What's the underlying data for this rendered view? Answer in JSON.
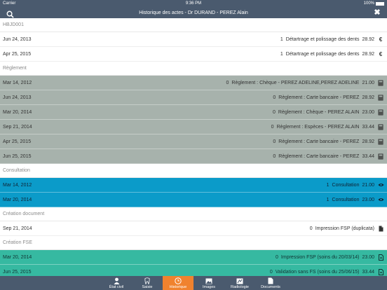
{
  "status_bar": {
    "carrier": "Carrier",
    "time": "9:36 PM",
    "battery": "100%"
  },
  "nav": {
    "title": "Historique des actes -  Dr DURAND - PEREZ Alain",
    "left_icon": "search-icon",
    "right_icon": "close-icon"
  },
  "sections": [
    {
      "header": "HBJD001",
      "style": "white",
      "rows": [
        {
          "date": "Jun 24, 2013",
          "qty": "1",
          "label": "Détartrage et polissage des dents",
          "price": "28.92",
          "icon": "euro-icon"
        },
        {
          "date": "Apr 25, 2015",
          "qty": "1",
          "label": "Détartrage et polissage des dents",
          "price": "28.92",
          "icon": "euro-icon"
        }
      ]
    },
    {
      "header": "Règlement",
      "style": "gray",
      "rows": [
        {
          "date": "Mar 14, 2012",
          "qty": "0",
          "label": "Règlement : Chèque - PEREZ ADELINE,PEREZ ADELINE",
          "price": "21.00",
          "icon": "calculator-icon"
        },
        {
          "date": "Jun 24, 2013",
          "qty": "0",
          "label": "Règlement : Carte bancaire - PEREZ",
          "price": "28.92",
          "icon": "calculator-icon"
        },
        {
          "date": "Mar 20, 2014",
          "qty": "0",
          "label": "Règlement : Chèque - PEREZ ALAIN",
          "price": "23.00",
          "icon": "calculator-icon"
        },
        {
          "date": "Sep 21, 2014",
          "qty": "0",
          "label": "Règlement : Espèces - PEREZ ALAIN",
          "price": "33.44",
          "icon": "calculator-icon"
        },
        {
          "date": "Apr 25, 2015",
          "qty": "0",
          "label": "Règlement : Carte bancaire - PEREZ",
          "price": "28.92",
          "icon": "calculator-icon"
        },
        {
          "date": "Jun 25, 2015",
          "qty": "0",
          "label": "Règlement : Carte bancaire - PEREZ",
          "price": "33.44",
          "icon": "calculator-icon"
        }
      ]
    },
    {
      "header": "Consultation",
      "style": "blue",
      "rows": [
        {
          "date": "Mar 14, 2012",
          "qty": "1",
          "label": "Consultation",
          "price": "21.00",
          "icon": "eye-icon"
        },
        {
          "date": "Mar 20, 2014",
          "qty": "1",
          "label": "Consultation",
          "price": "23.00",
          "icon": "eye-icon"
        }
      ]
    },
    {
      "header": "Création document",
      "style": "white",
      "rows": [
        {
          "date": "Sep 21, 2014",
          "qty": "0",
          "label": "Impression FSP (duplicata)",
          "price": "",
          "icon": "document-icon"
        }
      ]
    },
    {
      "header": "Création FSE",
      "style": "teal",
      "rows": [
        {
          "date": "Mar 20, 2014",
          "qty": "0",
          "label": "Impression FSP (soins du 20/03/14)",
          "price": "23.00",
          "icon": "pdf-icon"
        },
        {
          "date": "Jun 25, 2015",
          "qty": "0",
          "label": "Validation sans FS (soins du 25/06/15)",
          "price": "33.44",
          "icon": "pdf-icon"
        }
      ]
    }
  ],
  "tabs": [
    {
      "label": "État civil",
      "icon": "person-icon",
      "active": false
    },
    {
      "label": "Saisie",
      "icon": "tooth-icon",
      "active": false
    },
    {
      "label": "Historique",
      "icon": "clock-icon",
      "active": true
    },
    {
      "label": "Images",
      "icon": "image-icon",
      "active": false
    },
    {
      "label": "Radiologie",
      "icon": "xray-icon",
      "active": false
    },
    {
      "label": "Documents",
      "icon": "documents-icon",
      "active": false
    }
  ],
  "colors": {
    "navbar": "#4a5a6e",
    "gray_row": "#a7b2ac",
    "blue_row": "#0b9bc9",
    "teal_row": "#36b9a1",
    "active_tab": "#f0822e"
  }
}
